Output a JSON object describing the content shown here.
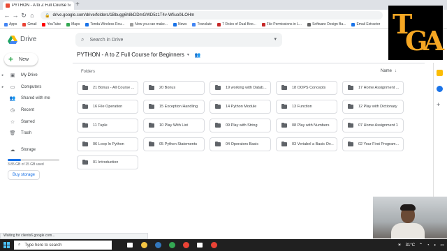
{
  "browser": {
    "tab_title": "PYTHON - A to Z Full Course fo",
    "tab_close": "×",
    "new_tab": "+",
    "url": "drive.google.com/drive/folders/1Bbugg6h8kDDmGWD5z1T4v-Wfiuo0iLOHm",
    "bookmarks": [
      "Apps",
      "Gmail",
      "YouTube",
      "Maps",
      "Tenda Wireless Rou...",
      "Now you can make...",
      "News",
      "Translate",
      "7 Roles of Dual Boo...",
      "File Permissions in L...",
      "Software Design Ba...",
      "Email Extractor"
    ],
    "bookmark_colors": [
      "#4285f4",
      "#ea4335",
      "#ff0000",
      "#34a853",
      "#1a73e8",
      "#9e9e9e",
      "#1a73e8",
      "#4285f4",
      "#c62828",
      "#c62828",
      "#616161",
      "#1a73e8"
    ]
  },
  "drive": {
    "brand": "Drive",
    "search_placeholder": "Search in Drive",
    "new_label": "New",
    "sidebar": [
      {
        "label": "My Drive",
        "icon": "my-drive-icon",
        "glyph": "▣",
        "expand": true
      },
      {
        "label": "Computers",
        "icon": "computer-icon",
        "glyph": "▭",
        "expand": true
      },
      {
        "label": "Shared with me",
        "icon": "shared-icon",
        "glyph": "👥",
        "expand": false
      },
      {
        "label": "Recent",
        "icon": "clock-icon",
        "glyph": "◷",
        "expand": false
      },
      {
        "label": "Starred",
        "icon": "star-icon",
        "glyph": "☆",
        "expand": false
      },
      {
        "label": "Trash",
        "icon": "trash-icon",
        "glyph": "🗑",
        "expand": false
      },
      {
        "label": "Storage",
        "icon": "cloud-icon",
        "glyph": "☁",
        "expand": false
      }
    ],
    "storage_used_fraction": 0.257,
    "storage_text": "3.85 GB of 15 GB used",
    "buy_storage": "Buy storage",
    "folder_path": "PYTHON - A to Z Full Course for Beginners",
    "section_label": "Folders",
    "sort_label": "Name",
    "folders": [
      "21 Bonus - All Course ...",
      "20 Bonus",
      "19 working with Datab...",
      "18 OOPS Concepts",
      "17 Home Assignment ...",
      "16 File Operation",
      "15 Exception Handling",
      "14 Python Module",
      "13 Function",
      "12 Play with Dictionary",
      "11 Tuple",
      "10 Play With List",
      "09 Play with String",
      "08 Play with Numbers",
      "07 Home Assignment 1",
      "06 Loop In Python",
      "05 Python Statements",
      "04 Operators Basic",
      "03 Veriabel a Basic Ov...",
      "02 Your First Program...",
      "01 Introduction"
    ]
  },
  "status_text": "Waiting for clients6.google.com...",
  "taskbar": {
    "search_placeholder": "Type here to search",
    "temperature": "31°C",
    "apps": [
      "task-view-icon",
      "file-explorer-icon",
      "edge-icon",
      "chrome-green-icon",
      "chrome-icon",
      "store-icon",
      "chrome-profile-icon"
    ]
  },
  "overlay_logo": {
    "t": "T",
    "ga": "GA",
    "color": "#f6a723"
  }
}
